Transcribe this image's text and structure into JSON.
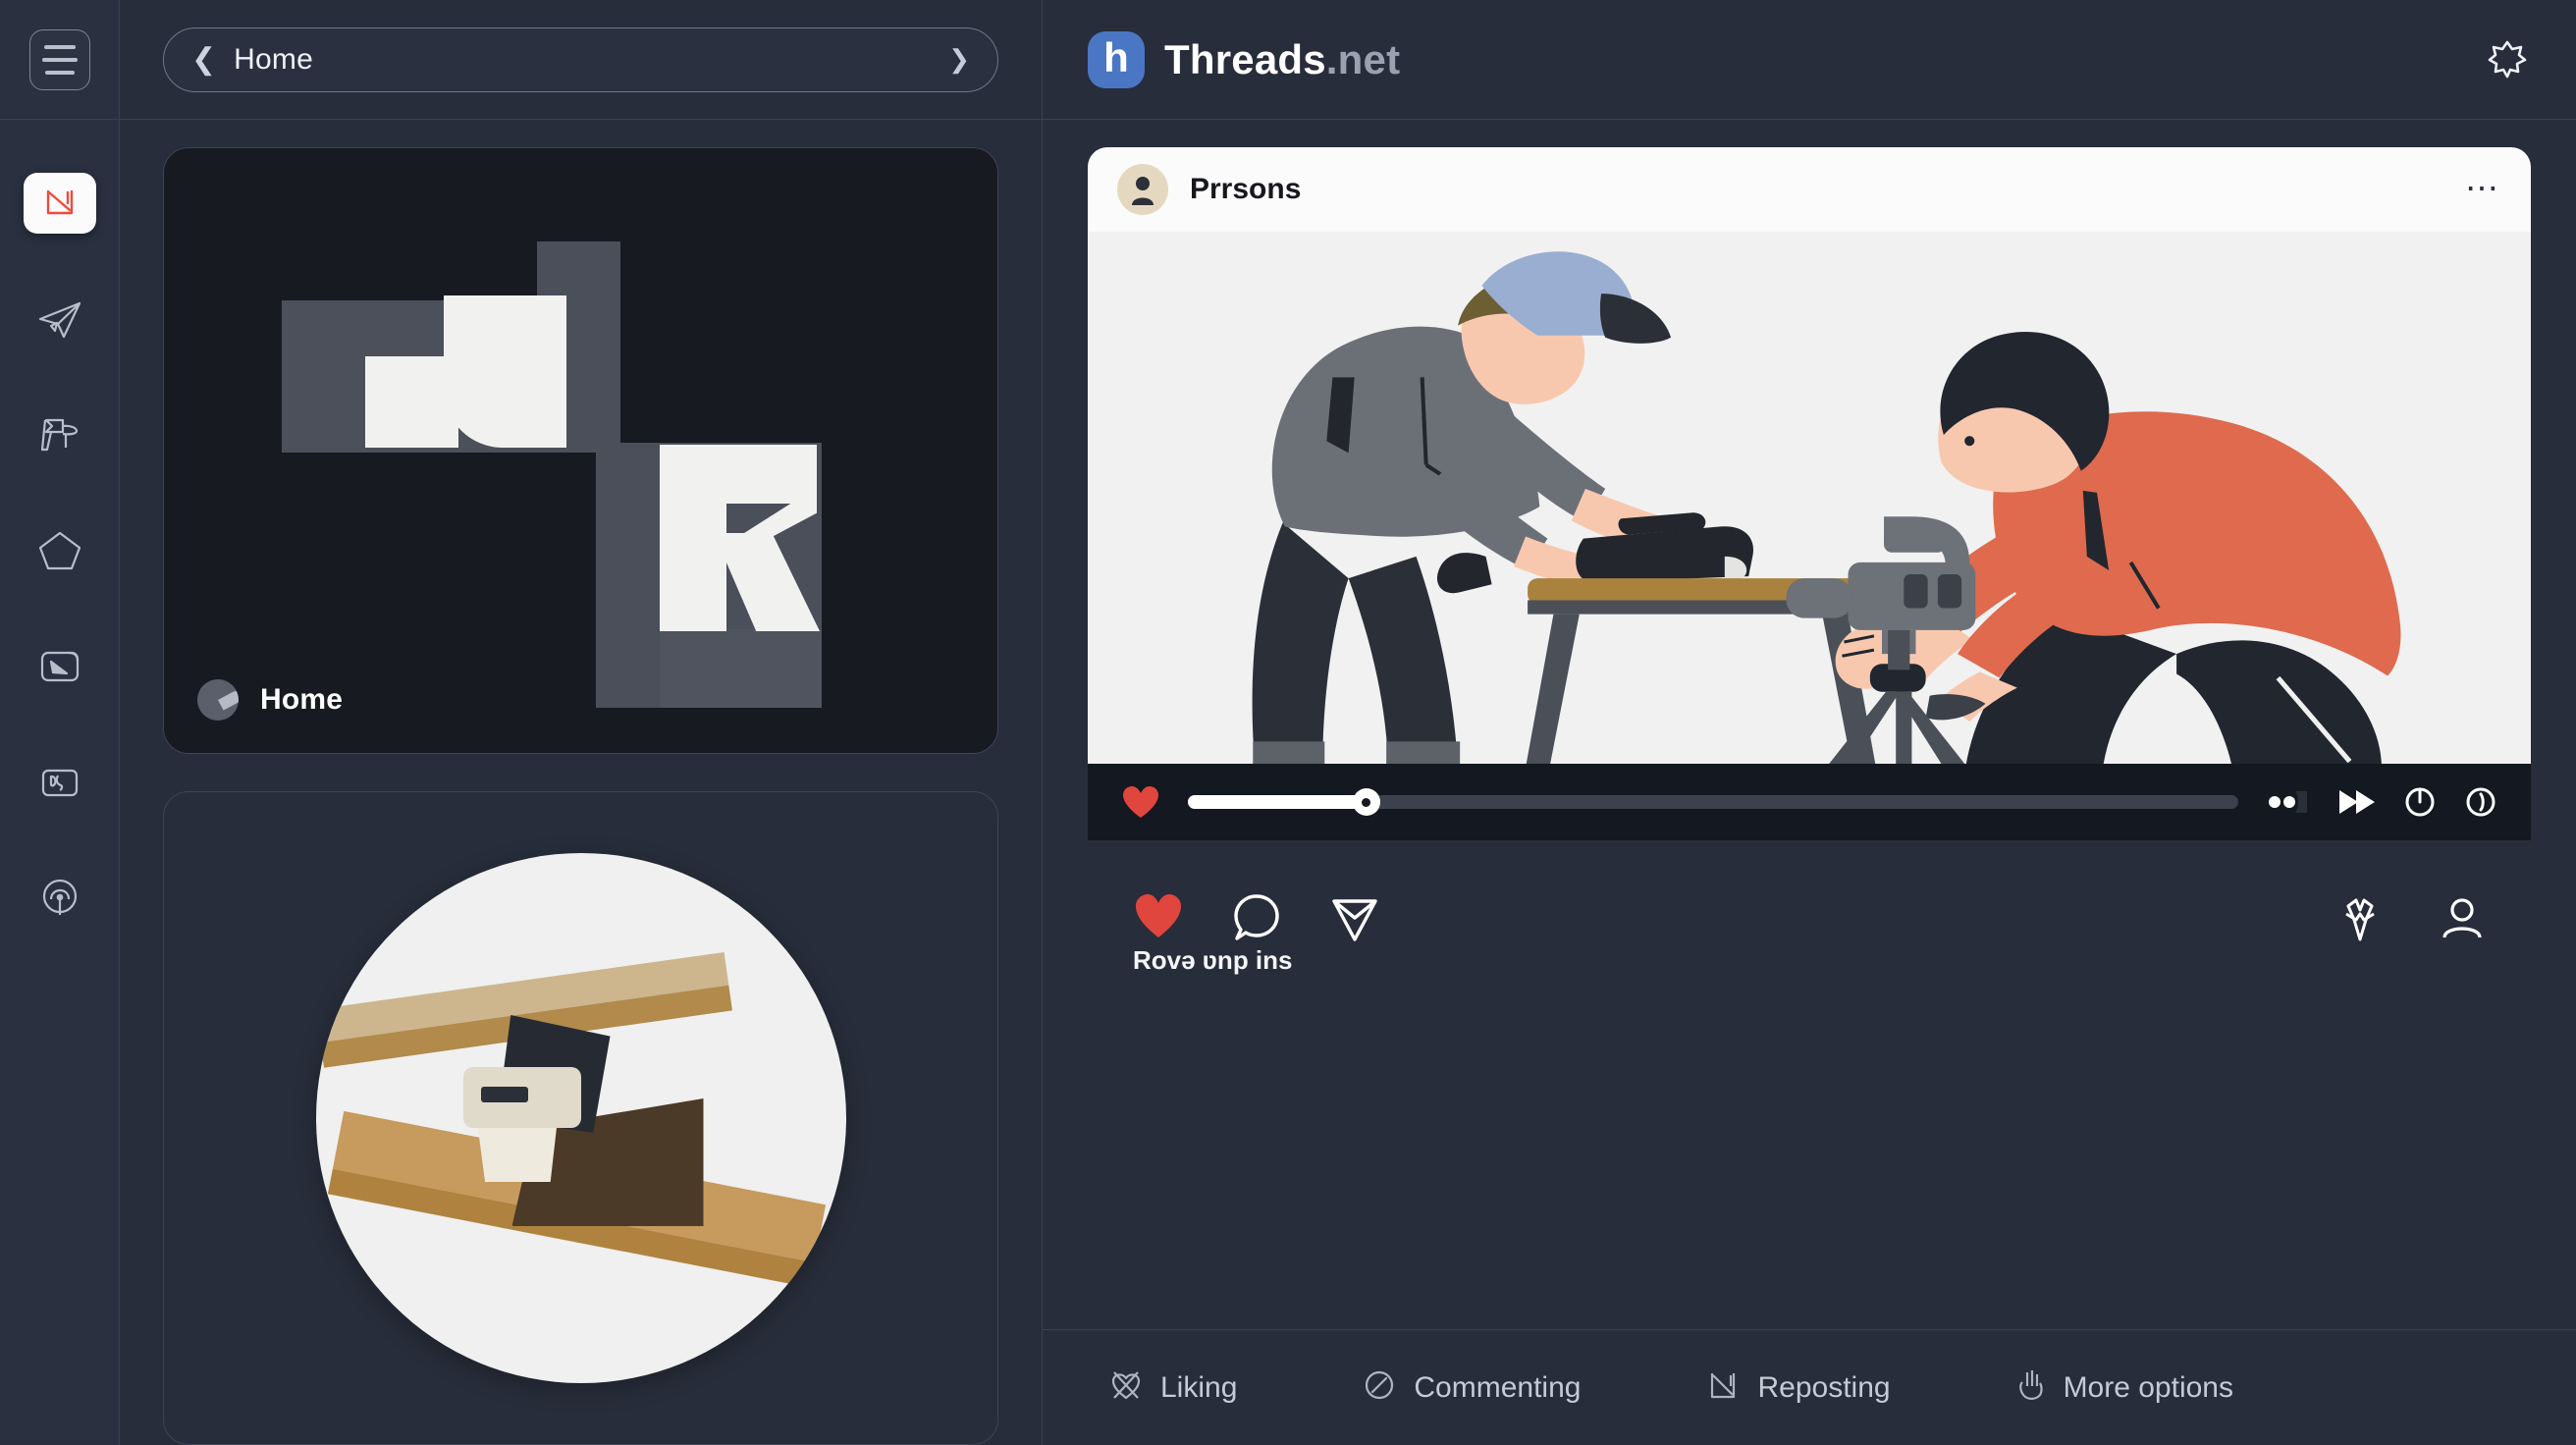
{
  "window": {
    "background_color": "#272d3a",
    "panel_border_color": "#3a4152"
  },
  "rail": {
    "menu_button": {
      "name": "hamburger-menu",
      "label": "Menu"
    },
    "items": [
      {
        "icon": "app-logo-icon",
        "label": "Library",
        "active": true
      },
      {
        "icon": "paper-plane-icon",
        "label": "Send",
        "active": false
      },
      {
        "icon": "flag-icon",
        "label": "Flag",
        "active": false
      },
      {
        "icon": "pentagon-icon",
        "label": "Shapes",
        "active": false
      },
      {
        "icon": "image-card-icon",
        "label": "Media",
        "active": false
      },
      {
        "icon": "profile-card-icon",
        "label": "Profile",
        "active": false
      },
      {
        "icon": "gauge-icon",
        "label": "Dashboard",
        "active": false
      }
    ]
  },
  "library": {
    "breadcrumb": {
      "back_icon": "chevron-left-icon",
      "title": "Home",
      "dropdown_icon": "chevron-down-icon"
    },
    "cards": [
      {
        "id": "home-card",
        "label": "Home",
        "badge_icon": "pie-slice-icon",
        "art": "abstract-letterform-art"
      },
      {
        "id": "tool-card",
        "label": "",
        "art": "hand-plane-illustration"
      }
    ]
  },
  "header": {
    "logo_letter": "h",
    "logo_color": "#4a76c4",
    "brand_name": "Threads",
    "brand_tld": ".net",
    "settings_icon": "gear-icon"
  },
  "post": {
    "author": "Prrsons",
    "avatar_icon": "user-avatar-icon",
    "more_icon": "more-horizontal-icon",
    "media": {
      "alt": "Two illustrated people: a carpenter planing wood on a sawhorse and a videographer filming with a camera on a tripod",
      "background_color": "#f0f0f0",
      "colors": {
        "skin": "#f7c6ae",
        "cap": "#9aaed1",
        "shirt_gray": "#6b7077",
        "shirt_red": "#df6a4e",
        "pants_dark": "#2b2f38",
        "wood": "#a9833e",
        "camera_gray": "#6d7178"
      }
    },
    "player": {
      "like_icon": "heart-filled-icon",
      "progress_percent": 17,
      "controls": [
        {
          "icon": "volume-icon",
          "label": "Volume"
        },
        {
          "icon": "fast-forward-icon",
          "label": "Fast forward"
        },
        {
          "icon": "power-icon",
          "label": "Power"
        },
        {
          "icon": "info-circle-icon",
          "label": "Info"
        }
      ]
    },
    "actions": {
      "left": [
        {
          "icon": "heart-filled-icon",
          "label": "Like"
        },
        {
          "icon": "comment-icon",
          "label": "Comment"
        },
        {
          "icon": "share-icon",
          "label": "Share"
        }
      ],
      "right": [
        {
          "icon": "repost-icon",
          "label": "Repost"
        },
        {
          "icon": "person-icon",
          "label": "Profile"
        }
      ],
      "likes_text": "Rovə ʋnp ins"
    }
  },
  "bottombar": {
    "items": [
      {
        "icon": "like-outline-icon",
        "label": "Liking"
      },
      {
        "icon": "comment-circle-icon",
        "label": "Commenting"
      },
      {
        "icon": "repost-bracket-icon",
        "label": "Reposting"
      },
      {
        "icon": "more-options-hand-icon",
        "label": "More options"
      }
    ]
  }
}
